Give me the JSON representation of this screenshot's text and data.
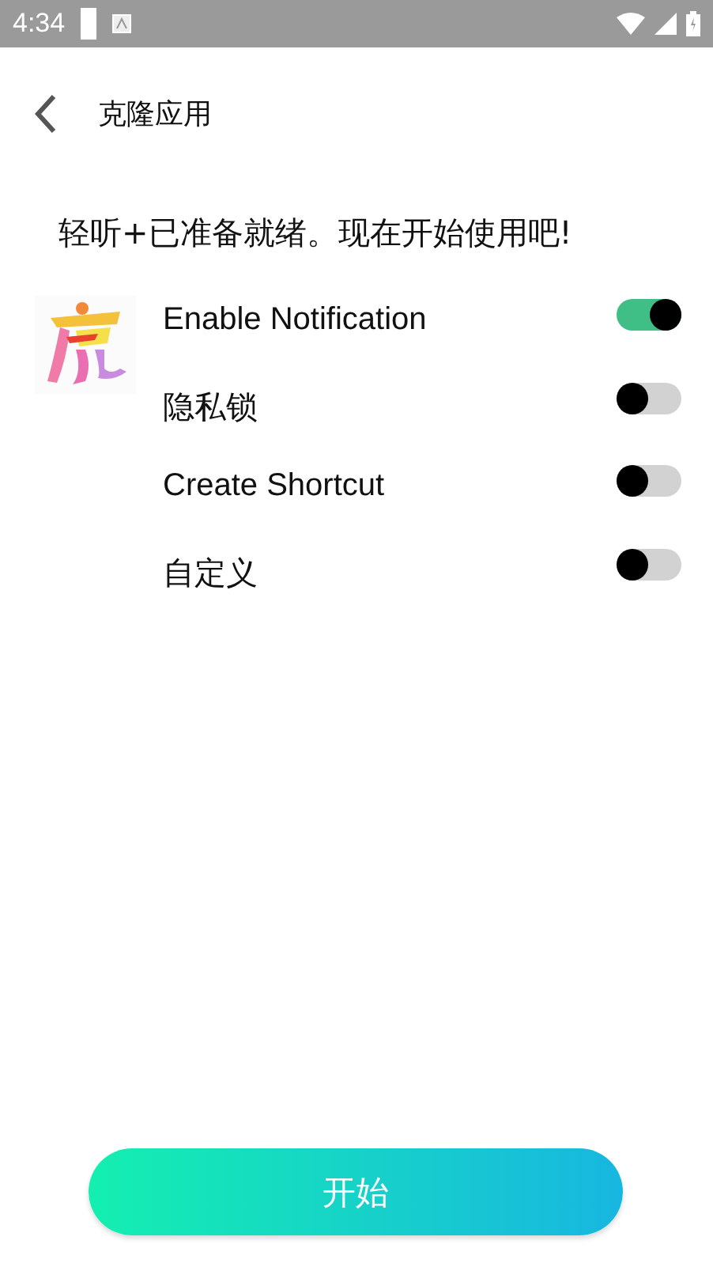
{
  "status_bar": {
    "time": "4:34"
  },
  "header": {
    "title": "克隆应用"
  },
  "message": "轻听+已准备就绪。现在开始使用吧!",
  "options": [
    {
      "label": "Enable Notification",
      "on": true
    },
    {
      "label": "隐私锁",
      "on": false
    },
    {
      "label": "Create Shortcut",
      "on": false
    },
    {
      "label": "自定义",
      "on": false
    }
  ],
  "start_button": {
    "label": "开始"
  }
}
